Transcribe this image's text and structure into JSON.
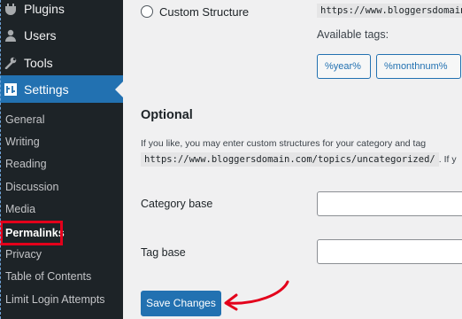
{
  "sidebar": {
    "menu": [
      {
        "label": "Plugins",
        "icon": "plugins-icon"
      },
      {
        "label": "Users",
        "icon": "users-icon"
      },
      {
        "label": "Tools",
        "icon": "tools-icon"
      },
      {
        "label": "Settings",
        "icon": "settings-icon"
      }
    ],
    "submenu": [
      {
        "label": "General"
      },
      {
        "label": "Writing"
      },
      {
        "label": "Reading"
      },
      {
        "label": "Discussion"
      },
      {
        "label": "Media"
      },
      {
        "label": "Permalinks",
        "current": true
      },
      {
        "label": "Privacy"
      },
      {
        "label": "Table of Contents"
      },
      {
        "label": "Limit Login Attempts"
      }
    ],
    "highlight_color": "#e3001b",
    "active_color": "#2271b1"
  },
  "main": {
    "custom_structure": {
      "label": "Custom Structure",
      "url_prefix": "https://www.bloggersdomain",
      "available_tags_label": "Available tags:",
      "tags": [
        "%year%",
        "%monthnum%"
      ]
    },
    "optional": {
      "title": "Optional",
      "description": "If you like, you may enter custom structures for your category and tag",
      "example_url": "https://www.bloggersdomain.com/topics/uncategorized/",
      "after_example": ". If y"
    },
    "fields": [
      {
        "label": "Category base",
        "value": ""
      },
      {
        "label": "Tag base",
        "value": ""
      }
    ],
    "save_label": "Save Changes",
    "annotation_color": "#e3001b"
  }
}
